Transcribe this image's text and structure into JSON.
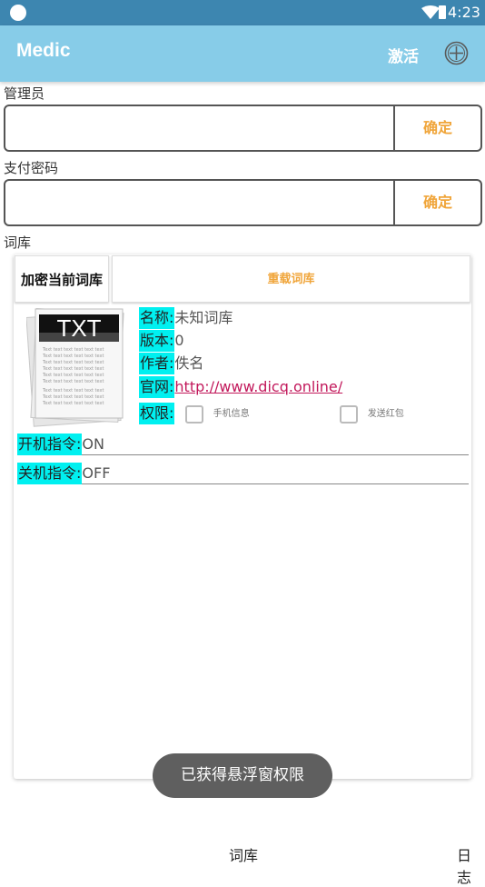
{
  "status_bar": {
    "time": "4:23"
  },
  "app_bar": {
    "title": "Medic",
    "activate_label": "激活"
  },
  "admin": {
    "label": "管理员",
    "value": "",
    "confirm_label": "确定"
  },
  "pay_password": {
    "label": "支付密码",
    "value": "",
    "confirm_label": "确定"
  },
  "library": {
    "label": "词库",
    "encrypt_button": "加密当前词库",
    "reload_button": "重载词库",
    "icon_text": "TXT",
    "icon_lines": "Text text text text text text",
    "info": {
      "name_label": "名称:",
      "name_value": "未知词库",
      "version_label": "版本:",
      "version_value": "0",
      "author_label": "作者:",
      "author_value": "佚名",
      "site_label": "官网:",
      "site_value": "http://www.dicq.online/",
      "perm_label": "权限:",
      "perm_phone": "手机信息",
      "perm_redpacket": "发送红包"
    },
    "startup_cmd": {
      "label": "开机指令:",
      "value": "ON"
    },
    "shutdown_cmd": {
      "label": "关机指令:",
      "value": "OFF"
    }
  },
  "toast": "已获得悬浮窗权限",
  "bottom_nav": {
    "tab_library": "词库",
    "tab_log": "日志"
  },
  "colors": {
    "status_bar": "#3d86b0",
    "app_bar": "#87cce8",
    "accent": "#f0a53a",
    "tag": "#00f0f0",
    "link": "#c2185b"
  },
  "icons": [
    "wifi-icon",
    "battery-icon",
    "add-circle-icon",
    "txt-file-icon",
    "checkbox-icon"
  ]
}
